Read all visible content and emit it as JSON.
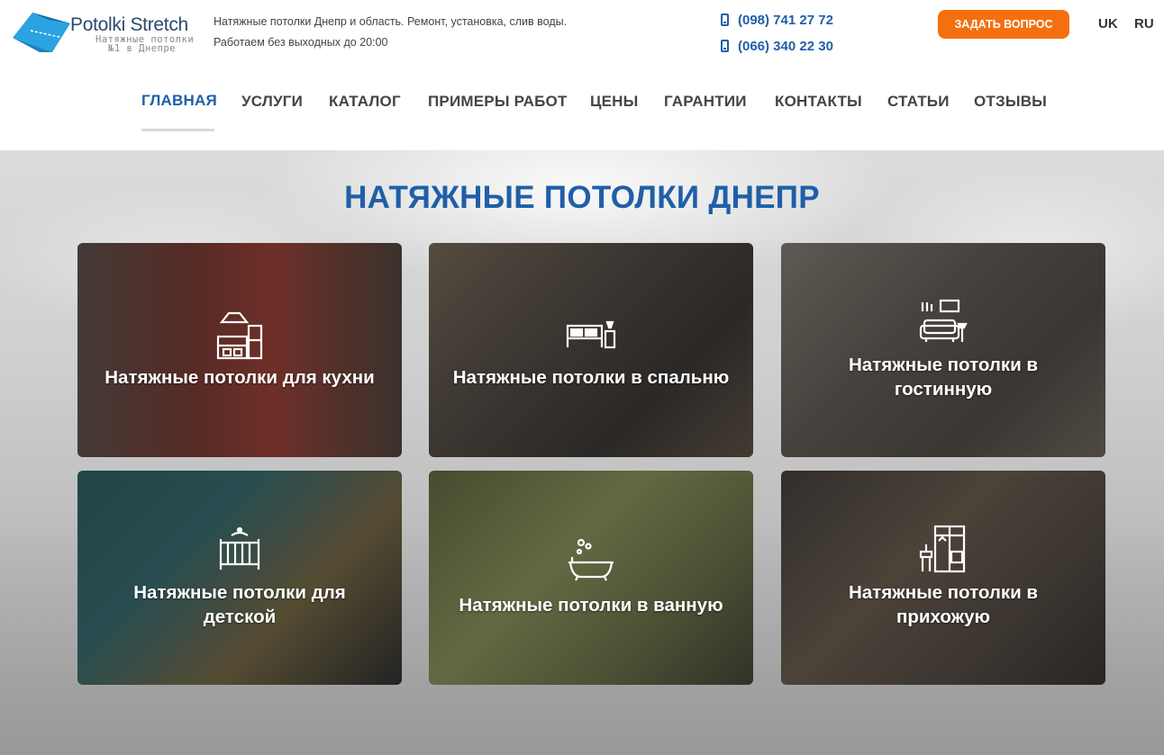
{
  "header": {
    "logo": {
      "name": "Potolki Stretch",
      "tagline_line1": "Натяжные потолки",
      "tagline_line2": "№1 в Днепре"
    },
    "tagline_line1": "Натяжные потолки Днепр и область. Ремонт, установка, слив воды.",
    "tagline_line2": "Работаем без выходных до 20:00",
    "phones": [
      "(098) 741 27 72",
      "(066) 340 22 30"
    ],
    "ask_button": "ЗАДАТЬ ВОПРОС",
    "languages": [
      "UK",
      "RU"
    ],
    "accent_color": "#1f5fa8",
    "button_color": "#f4700f"
  },
  "nav": {
    "items": [
      {
        "label": "ГЛАВНАЯ",
        "active": true
      },
      {
        "label": "УСЛУГИ"
      },
      {
        "label": "КАТАЛОГ"
      },
      {
        "label": "ПРИМЕРЫ РАБОТ"
      },
      {
        "label": "ЦЕНЫ"
      },
      {
        "label": "ГАРАНТИИ"
      },
      {
        "label": "КОНТАКТЫ"
      },
      {
        "label": "СТАТЬИ"
      },
      {
        "label": "ОТЗЫВЫ"
      }
    ]
  },
  "hero": {
    "title": "НАТЯЖНЫЕ ПОТОЛКИ ДНЕПР",
    "cards": [
      {
        "label_line1": "Натяжные потолки для кухни",
        "label_line2": "",
        "icon": "kitchen-icon"
      },
      {
        "label_line1": "Натяжные потолки в спальню",
        "label_line2": "",
        "icon": "bed-icon"
      },
      {
        "label_line1": "Натяжные потолки в",
        "label_line2": "гостинную",
        "icon": "sofa-icon"
      },
      {
        "label_line1": "Натяжные потолки для",
        "label_line2": "детской",
        "icon": "crib-icon"
      },
      {
        "label_line1": "Натяжные потолки в ванную",
        "label_line2": "",
        "icon": "bathtub-icon"
      },
      {
        "label_line1": "Натяжные потолки в",
        "label_line2": "прихожую",
        "icon": "wardrobe-icon"
      }
    ]
  }
}
